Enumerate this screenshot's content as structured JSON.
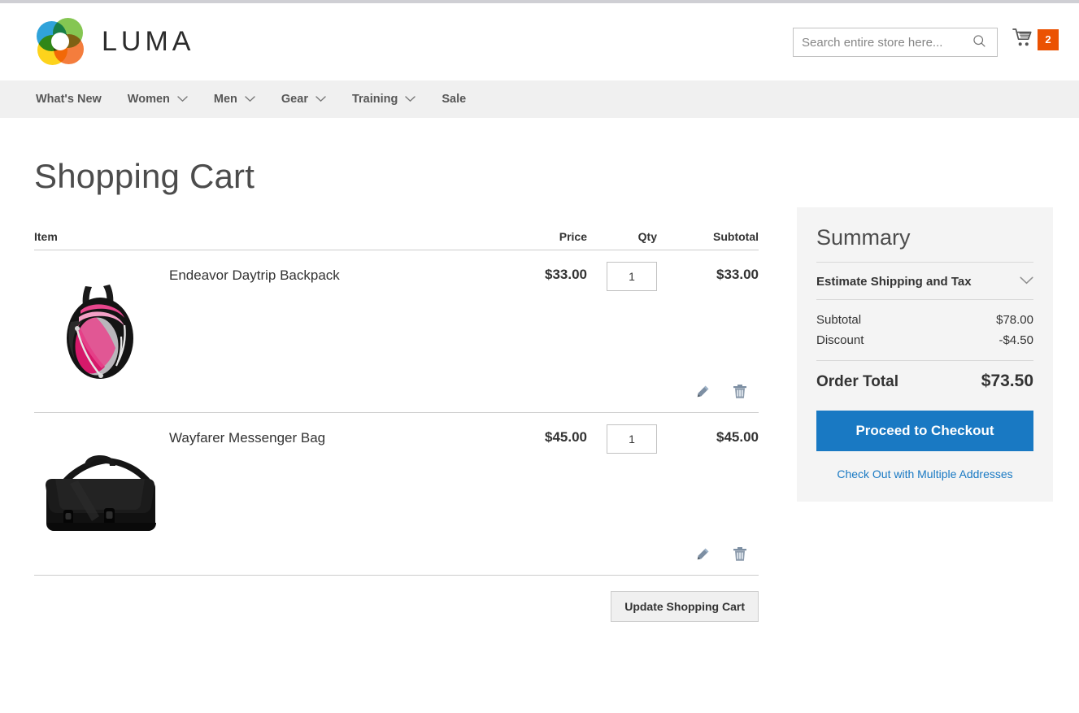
{
  "header": {
    "logo_text": "LUMA",
    "logo_icon": "luma-rings-logo",
    "search": {
      "placeholder": "Search entire store here...",
      "value": "",
      "icon": "search-icon"
    },
    "cart": {
      "icon": "shopping-cart-icon",
      "count": "2",
      "badge_color": "#eb5202"
    }
  },
  "nav": {
    "items": [
      {
        "label": "What's New",
        "has_menu": false
      },
      {
        "label": "Women",
        "has_menu": true
      },
      {
        "label": "Men",
        "has_menu": true
      },
      {
        "label": "Gear",
        "has_menu": true
      },
      {
        "label": "Training",
        "has_menu": true
      },
      {
        "label": "Sale",
        "has_menu": false
      }
    ]
  },
  "page": {
    "title": "Shopping Cart"
  },
  "cart_table": {
    "headers": {
      "item": "Item",
      "price": "Price",
      "qty": "Qty",
      "subtotal": "Subtotal"
    },
    "rows": [
      {
        "name": "Endeavor Daytrip Backpack",
        "price": "$33.00",
        "qty": "1",
        "subtotal": "$33.00",
        "image": "pink-black-backpack",
        "edit_icon": "pencil-edit-icon",
        "delete_icon": "trash-delete-icon"
      },
      {
        "name": "Wayfarer Messenger Bag",
        "price": "$45.00",
        "qty": "1",
        "subtotal": "$45.00",
        "image": "black-messenger-bag",
        "edit_icon": "pencil-edit-icon",
        "delete_icon": "trash-delete-icon"
      }
    ],
    "update_button": "Update Shopping Cart"
  },
  "summary": {
    "title": "Summary",
    "estimate_label": "Estimate Shipping and Tax",
    "estimate_icon": "chevron-down-icon",
    "subtotal_label": "Subtotal",
    "subtotal_value": "$78.00",
    "discount_label": "Discount",
    "discount_value": "-$4.50",
    "order_total_label": "Order Total",
    "order_total_value": "$73.50",
    "checkout_button": "Proceed to Checkout",
    "multi_address_link": "Check Out with Multiple Addresses",
    "accent_color": "#1979c3",
    "panel_color": "#f4f4f4"
  }
}
